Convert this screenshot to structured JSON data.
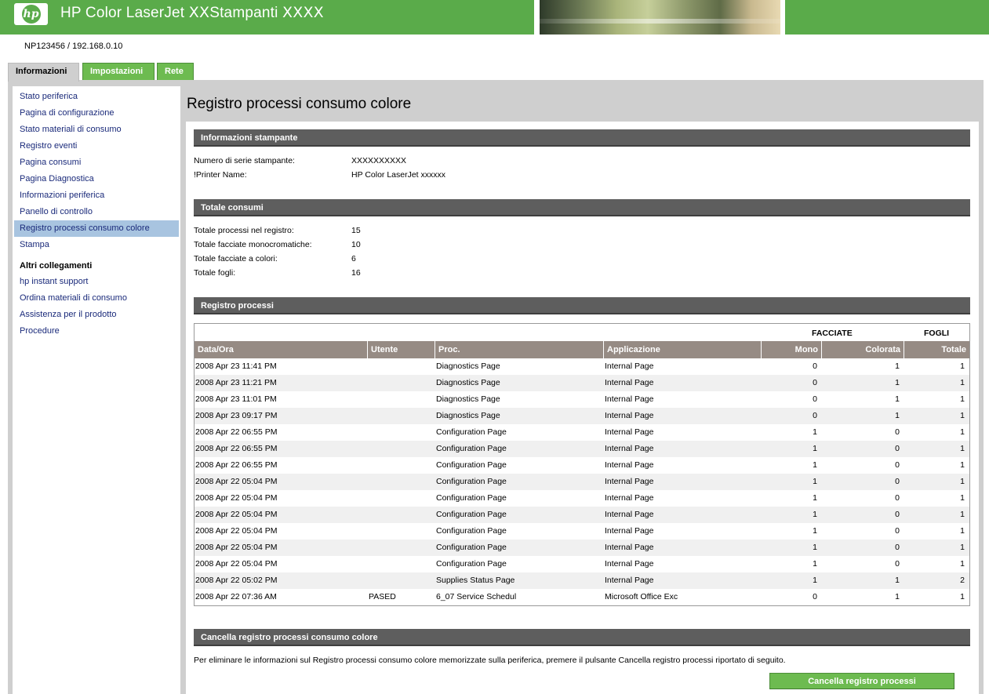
{
  "header": {
    "logo_text": "hp",
    "title": "HP Color LaserJet ⅩⅩStampanti ⅩⅩⅩⅩ"
  },
  "device_id": "NP123456 / 192.168.0.10",
  "tabs": [
    {
      "label": "Informazioni",
      "active": true
    },
    {
      "label": "Impostazioni",
      "active": false
    },
    {
      "label": "Rete",
      "active": false
    }
  ],
  "sidebar": {
    "items": [
      {
        "label": "Stato periferica"
      },
      {
        "label": "Pagina di configurazione"
      },
      {
        "label": "Stato materiali di consumo"
      },
      {
        "label": "Registro eventi"
      },
      {
        "label": "Pagina consumi"
      },
      {
        "label": "Pagina Diagnostica"
      },
      {
        "label": "Informazioni periferica"
      },
      {
        "label": "Panello di controllo"
      },
      {
        "label": "Registro processi consumo colore",
        "active": true
      },
      {
        "label": "Stampa"
      }
    ],
    "other_links_heading": "Altri collegamenti",
    "other_links": [
      {
        "label": "hp instant support"
      },
      {
        "label": "Ordina materiali di consumo"
      },
      {
        "label": "Assistenza per il prodotto"
      },
      {
        "label": "Procedure"
      }
    ]
  },
  "main": {
    "title": "Registro processi consumo colore",
    "printer_info": {
      "heading": "Informazioni stampante",
      "rows": [
        {
          "label": "Numero di serie stampante:",
          "value": "XXXXXXXXXX"
        },
        {
          "label": "!Printer Name:",
          "value": "HP Color LaserJet xxxxxx"
        }
      ]
    },
    "totals": {
      "heading": "Totale consumi",
      "rows": [
        {
          "label": "Totale processi nel registro:",
          "value": "15"
        },
        {
          "label": "Totale facciate monocromatiche:",
          "value": "10"
        },
        {
          "label": "Totale facciate a colori:",
          "value": "6"
        },
        {
          "label": "Totale fogli:",
          "value": "16"
        }
      ]
    },
    "job_log": {
      "heading": "Registro processi",
      "group_facciate": "FACCIATE",
      "group_fogli": "FOGLI",
      "columns": [
        "Data/Ora",
        "Utente",
        "Proc.",
        "Applicazione",
        "Mono",
        "Colorata",
        "Totale"
      ],
      "rows": [
        [
          "2008 Apr 23 11:41 PM",
          "",
          "Diagnostics Page",
          "Internal Page",
          "0",
          "1",
          "1"
        ],
        [
          "2008 Apr 23 11:21 PM",
          "",
          "Diagnostics Page",
          "Internal Page",
          "0",
          "1",
          "1"
        ],
        [
          "2008 Apr 23 11:01 PM",
          "",
          "Diagnostics Page",
          "Internal Page",
          "0",
          "1",
          "1"
        ],
        [
          "2008 Apr 23 09:17 PM",
          "",
          "Diagnostics Page",
          "Internal Page",
          "0",
          "1",
          "1"
        ],
        [
          "2008 Apr 22 06:55 PM",
          "",
          "Configuration Page",
          "Internal Page",
          "1",
          "0",
          "1"
        ],
        [
          "2008 Apr 22 06:55 PM",
          "",
          "Configuration Page",
          "Internal Page",
          "1",
          "0",
          "1"
        ],
        [
          "2008 Apr 22 06:55 PM",
          "",
          "Configuration Page",
          "Internal Page",
          "1",
          "0",
          "1"
        ],
        [
          "2008 Apr 22 05:04 PM",
          "",
          "Configuration Page",
          "Internal Page",
          "1",
          "0",
          "1"
        ],
        [
          "2008 Apr 22 05:04 PM",
          "",
          "Configuration Page",
          "Internal Page",
          "1",
          "0",
          "1"
        ],
        [
          "2008 Apr 22 05:04 PM",
          "",
          "Configuration Page",
          "Internal Page",
          "1",
          "0",
          "1"
        ],
        [
          "2008 Apr 22 05:04 PM",
          "",
          "Configuration Page",
          "Internal Page",
          "1",
          "0",
          "1"
        ],
        [
          "2008 Apr 22 05:04 PM",
          "",
          "Configuration Page",
          "Internal Page",
          "1",
          "0",
          "1"
        ],
        [
          "2008 Apr 22 05:04 PM",
          "",
          "Configuration Page",
          "Internal Page",
          "1",
          "0",
          "1"
        ],
        [
          "2008 Apr 22 05:02 PM",
          "",
          "Supplies Status Page",
          "Internal Page",
          "1",
          "1",
          "2"
        ],
        [
          "2008 Apr 22 07:36 AM",
          "PASED",
          "6_07 Service Schedul",
          "Microsoft Office Exc",
          "0",
          "1",
          "1"
        ]
      ]
    },
    "clear_log": {
      "heading": "Cancella registro processi consumo colore",
      "description": "Per eliminare le informazioni sul Registro processi consumo colore memorizzate sulla periferica, premere il pulsante Cancella registro processi riportato di seguito.",
      "button_label": "Cancella registro processi"
    }
  },
  "colors": {
    "brand_green": "#5aab4a",
    "tab_green": "#6dbb50",
    "section_bar": "#5e5e5e",
    "table_header": "#968b84",
    "nav_active": "#a8c4e0",
    "link": "#1a2a7a"
  }
}
